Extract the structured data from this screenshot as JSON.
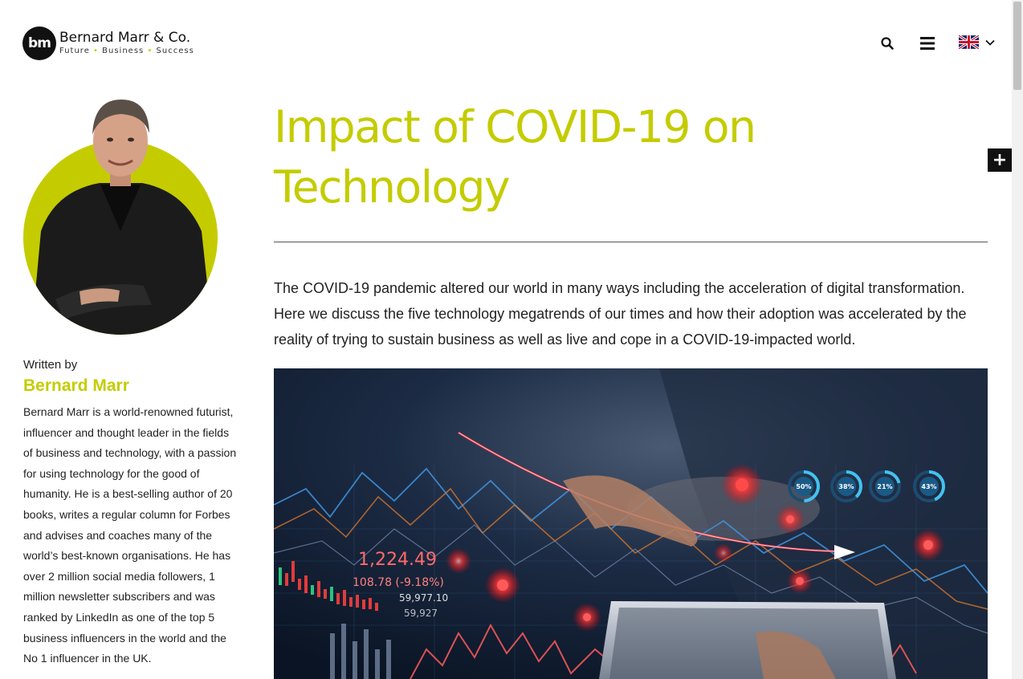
{
  "header": {
    "logo_mark": "bm",
    "logo_name": "Bernard Marr & Co.",
    "logo_tagline": [
      "Future",
      "Business",
      "Success"
    ],
    "search_icon": "search-icon",
    "menu_icon": "hamburger-menu-icon",
    "language_icon": "uk-flag-icon"
  },
  "sidebar": {
    "written_by": "Written by",
    "author_name": "Bernard Marr",
    "author_bio": "Bernard Marr is a world-renowned futurist, influencer and thought leader in the fields of business and technology, with a passion for using technology for the good of humanity. He is a best-selling author of 20 books, writes a regular column for Forbes and advises and coaches many of the world’s best-known organisations. He has over 2 million social media followers, 1 million newsletter subscribers and was ranked by LinkedIn as one of the top 5 business influencers in the world and the No 1 influencer in the UK."
  },
  "article": {
    "title": "Impact of COVID-19 on Technology",
    "intro": "The COVID-19 pandemic altered our world in many ways including the acceleration of digital transformation. Here we discuss the five technology megatrends of our times and how their adoption was accelerated by the reality of trying to sustain business as well as live and cope in a COVID-19-impacted world.",
    "hero_image": {
      "big_number": "1,224.49",
      "change": "108.78 (-9.18%)",
      "small_number_1": "59,977.10",
      "small_number_2": "59,927",
      "gauges": [
        "50%",
        "38%",
        "21%",
        "43%"
      ]
    }
  },
  "floating": {
    "plus_label": "+"
  },
  "colors": {
    "accent": "#c4cc00",
    "dark": "#111111"
  }
}
